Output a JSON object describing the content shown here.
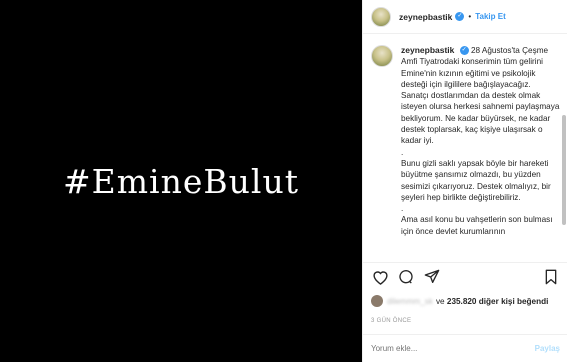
{
  "media": {
    "text": "#EmineBulut",
    "background": "#000000"
  },
  "header": {
    "username": "zeynepbastik",
    "separator": "•",
    "follow_label": "Takip Et"
  },
  "caption": {
    "username": "zeynepbastik",
    "text": "28 Ağustos'ta Çeşme Amfi Tiyatrodaki konserimin tüm gelirini Emine'nin kızının eğitimi ve psikolojik desteği için ilgililere bağışlayacağız. Sanatçı dostlarımdan da destek olmak isteyen olursa herkesi sahnemi paylaşmaya bekliyorum. Ne kadar büyürsek, ne kadar destek toplarsak, kaç kişiye ulaşırsak o kadar iyi.\n.\nBunu gizli saklı yapsak böyle bir hareketi büyütme şansımız olmazdı, bu yüzden sesimizi çıkarıyoruz. Destek olmalıyız, bir şeyleri hep birlikte değiştirebiliriz.\n.\nAma asıl konu bu vahşetlerin son bulması için önce devlet kurumlarının"
  },
  "likes": {
    "blurred_user": "dilemmm_sk",
    "connector": "ve",
    "count": "235.820",
    "suffix": "diğer kişi beğendi"
  },
  "timestamp": "3 GÜN ÖNCE",
  "comment_box": {
    "placeholder": "Yorum ekle...",
    "post_label": "Paylaş"
  },
  "icons": {
    "like": "heart-icon",
    "comment": "comment-icon",
    "share": "share-icon",
    "save": "bookmark-icon",
    "verified": "verified-badge-icon"
  },
  "colors": {
    "accent": "#3897f0",
    "muted": "#999999",
    "post_disabled": "#b2dffc"
  }
}
